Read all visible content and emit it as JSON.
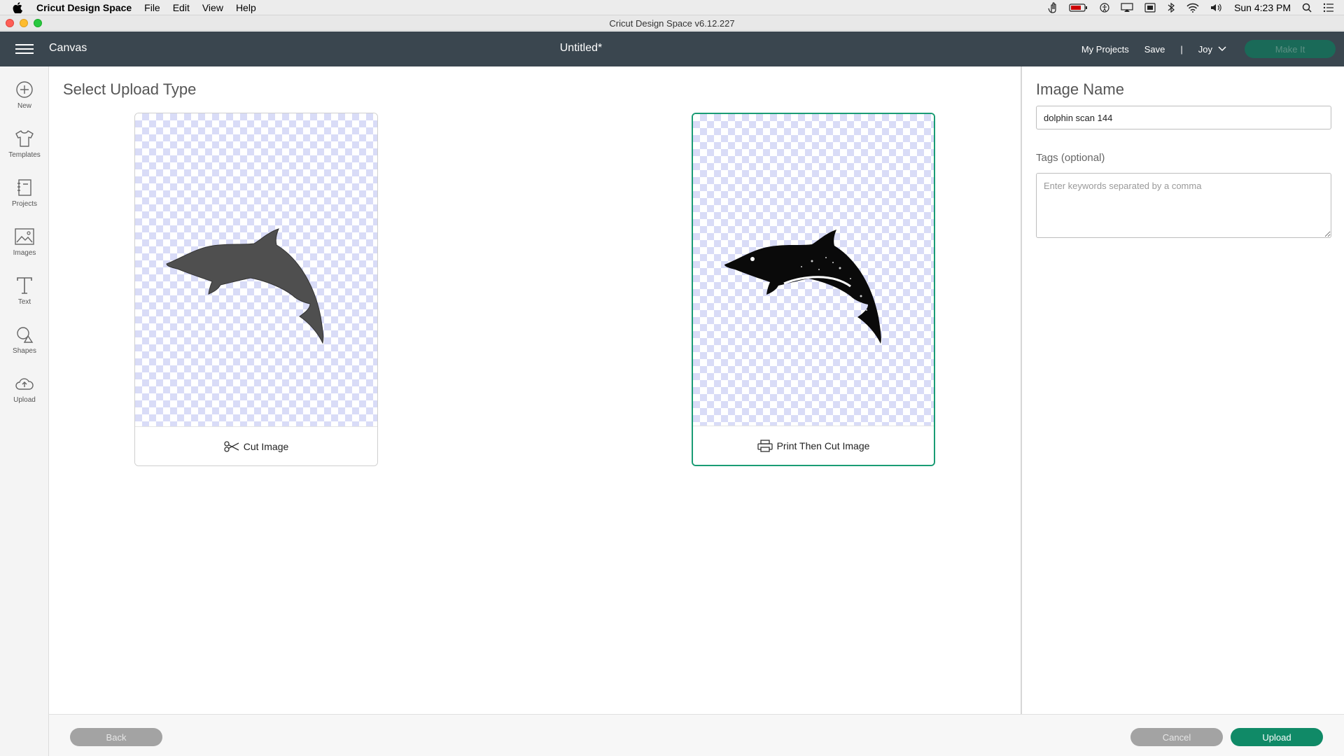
{
  "menubar": {
    "app_name": "Cricut Design Space",
    "items": [
      "File",
      "Edit",
      "View",
      "Help"
    ],
    "clock": "Sun 4:23 PM"
  },
  "window": {
    "title": "Cricut Design Space  v6.12.227"
  },
  "header": {
    "canvas_label": "Canvas",
    "doc_title": "Untitled*",
    "my_projects": "My Projects",
    "save": "Save",
    "separator": "|",
    "user": "Joy",
    "make_it": "Make It"
  },
  "sidebar": {
    "tools": [
      {
        "label": "New",
        "icon": "plus-circle-icon"
      },
      {
        "label": "Templates",
        "icon": "tshirt-icon"
      },
      {
        "label": "Projects",
        "icon": "notebook-icon"
      },
      {
        "label": "Images",
        "icon": "image-icon"
      },
      {
        "label": "Text",
        "icon": "text-t-icon"
      },
      {
        "label": "Shapes",
        "icon": "shapes-icon"
      },
      {
        "label": "Upload",
        "icon": "cloud-upload-icon"
      }
    ]
  },
  "main": {
    "heading": "Select Upload Type",
    "options": [
      {
        "label": "Cut Image",
        "icon": "scissors-icon",
        "selected": false
      },
      {
        "label": "Print Then Cut Image",
        "icon": "printer-icon",
        "selected": true
      }
    ]
  },
  "panel": {
    "title": "Image Name",
    "image_name": "dolphin scan 144",
    "tags_label": "Tags (optional)",
    "tags_placeholder": "Enter keywords separated by a comma"
  },
  "footer": {
    "back": "Back",
    "cancel": "Cancel",
    "upload": "Upload"
  },
  "colors": {
    "accent": "#108a67",
    "header_bg": "#3a464f",
    "checker": "#d9dcf7"
  }
}
